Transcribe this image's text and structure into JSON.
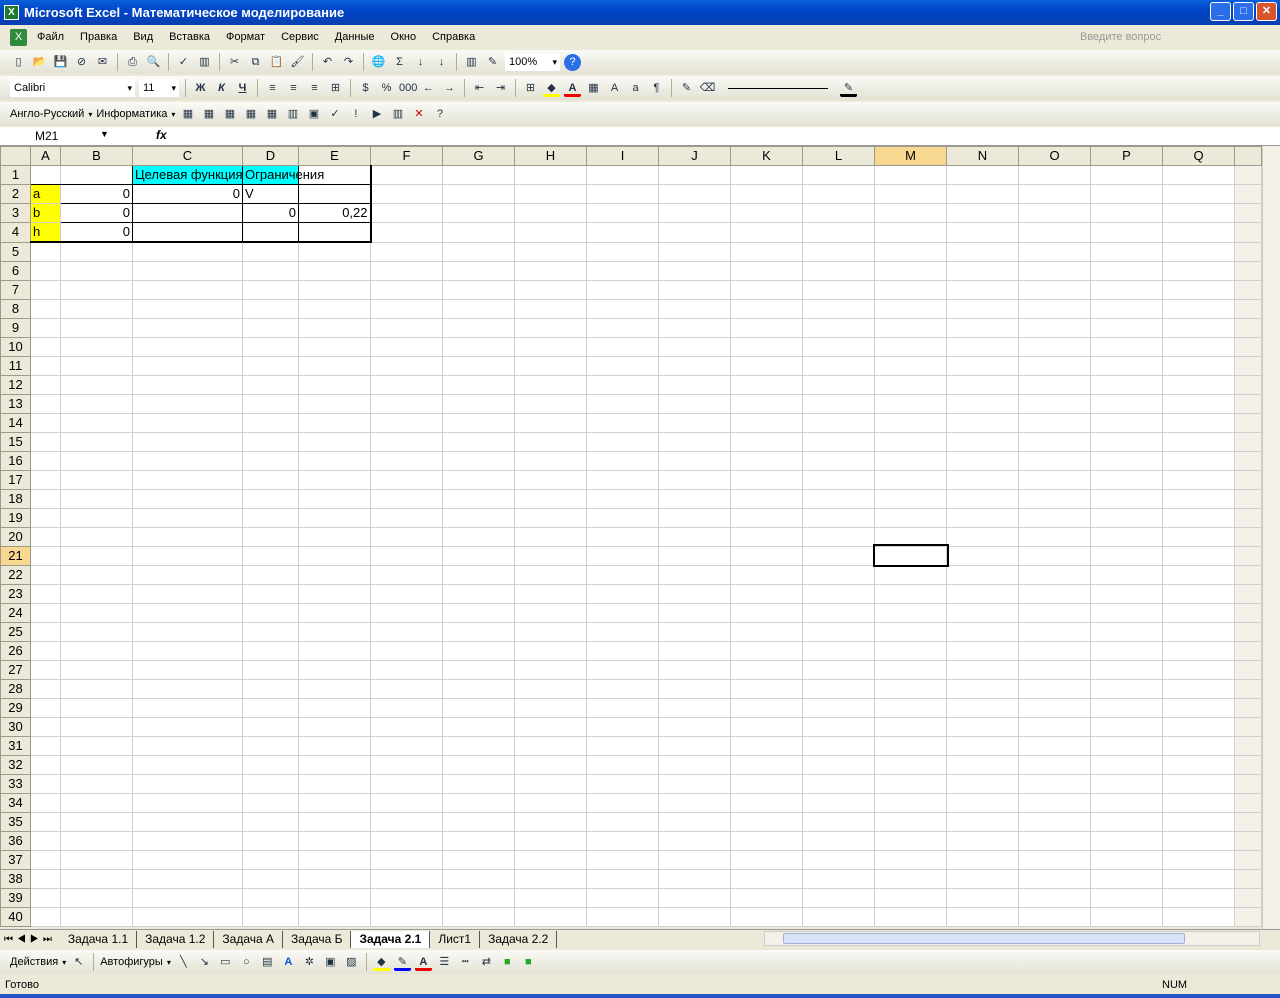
{
  "window": {
    "title": "Microsoft Excel - Математическое моделирование",
    "app_icon": "X"
  },
  "menu": [
    "Файл",
    "Правка",
    "Вид",
    "Вставка",
    "Формат",
    "Сервис",
    "Данные",
    "Окно",
    "Справка"
  ],
  "help_placeholder": "Введите вопрос",
  "standard_toolbar": {
    "icons": [
      "new-icon",
      "open-icon",
      "save-icon",
      "permission-icon",
      "email-icon",
      "print-icon",
      "preview-icon",
      "spelling-icon",
      "research-icon",
      "cut-icon",
      "copy-icon",
      "paste-icon",
      "format-painter-icon",
      "undo-icon",
      "redo-icon",
      "hyperlink-icon",
      "autosum-icon",
      "sort-asc-icon",
      "sort-desc-icon",
      "chart-wizard-icon",
      "drawing-icon"
    ],
    "zoom": "100%"
  },
  "formatting_toolbar": {
    "font": "Calibri",
    "size": "11",
    "bold": "Ж",
    "italic": "К",
    "underline": "Ч",
    "percent": "%",
    "thousands": "000"
  },
  "custom_toolbar": {
    "dict": "Англо-Русский",
    "informatika": "Информатика"
  },
  "formula_bar": {
    "name_box": "M21",
    "fx": "fx",
    "value": ""
  },
  "columns": [
    "A",
    "B",
    "C",
    "D",
    "E",
    "F",
    "G",
    "H",
    "I",
    "J",
    "K",
    "L",
    "M",
    "N",
    "O",
    "P",
    "Q"
  ],
  "selected": {
    "col": "M",
    "row": 21
  },
  "cells": {
    "C1": "Целевая функция",
    "D1": "Ограничения",
    "A2": "a",
    "B2": "0",
    "C2": "0",
    "D2": "V",
    "A3": "b",
    "B3": "0",
    "D3": "0",
    "E3": "0,22",
    "A4": "h",
    "B4": "0"
  },
  "sheet_tabs": [
    "Задача 1.1",
    "Задача 1.2",
    "Задача А",
    "Задача Б",
    "Задача 2.1",
    "Лист1",
    "Задача 2.2"
  ],
  "active_tab": "Задача 2.1",
  "drawing_toolbar": {
    "actions": "Действия",
    "autoshapes": "Автофигуры"
  },
  "status": {
    "left": "Готово",
    "num": "NUM"
  },
  "colors": {
    "header_fill": "#00ffff",
    "label_fill": "#ffff00"
  }
}
